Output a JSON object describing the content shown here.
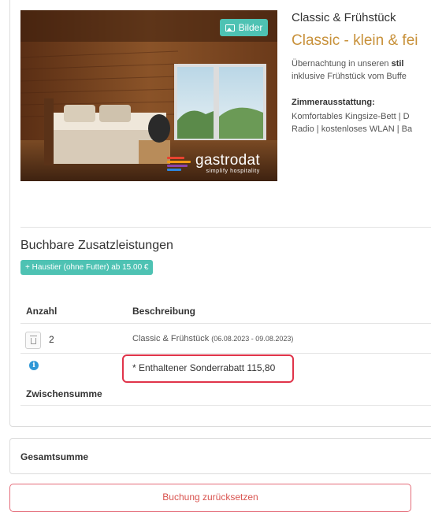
{
  "room": {
    "photo_button_label": "Bilder",
    "photo_icon": "image-icon",
    "brand_name": "gastrodat",
    "brand_tagline": "simplify hospitality",
    "brand_colors": [
      "#e8432f",
      "#f39c12",
      "#8e44ad",
      "#2e86de"
    ],
    "title": "Classic & Frühstück",
    "subtitle": "Classic - klein & fei",
    "desc_line1_prefix": "Übernachtung in unseren ",
    "desc_line1_bold": "stil",
    "desc_line2": "inklusive Frühstück vom Buffe",
    "amenities_label": "Zimmerausstattung:",
    "amenities_line1": "Komfortables Kingsize-Bett | D",
    "amenities_line2": "Radio | kostenloses WLAN | Ba"
  },
  "extras": {
    "title": "Buchbare Zusatzleistungen",
    "pet_button": "+ Haustier (ohne Futter)  ab 15.00 €"
  },
  "table": {
    "col_quantity": "Anzahl",
    "col_description": "Beschreibung",
    "row": {
      "quantity": "2",
      "description": "Classic & Frühstück",
      "dates": "(06.08.2023 - 09.08.2023)"
    },
    "discount_text": "* Enthaltener Sonderrabatt 115,80",
    "subtotal_label": "Zwischensumme"
  },
  "summary": {
    "total_label": "Gesamtsumme"
  },
  "actions": {
    "reset_label": "Buchung zurücksetzen"
  },
  "colors": {
    "accent": "#4ec2b3",
    "title_gold": "#c8913a",
    "info_blue": "#2f97d6",
    "danger": "#d9534f",
    "highlight_red": "#e0344a"
  }
}
